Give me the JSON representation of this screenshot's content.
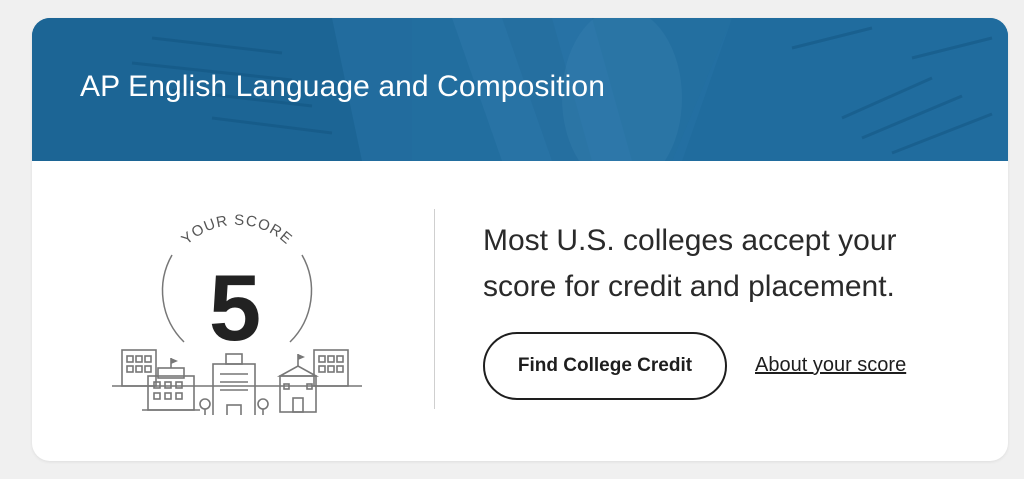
{
  "card": {
    "title": "AP English Language and Composition",
    "banner_color": "#1f6b9c"
  },
  "score": {
    "caption": "YOUR SCORE",
    "value": "5"
  },
  "message": "Most U.S. colleges accept your score for credit and placement.",
  "actions": {
    "find_credit_label": "Find College Credit",
    "about_score_label": "About your score"
  }
}
